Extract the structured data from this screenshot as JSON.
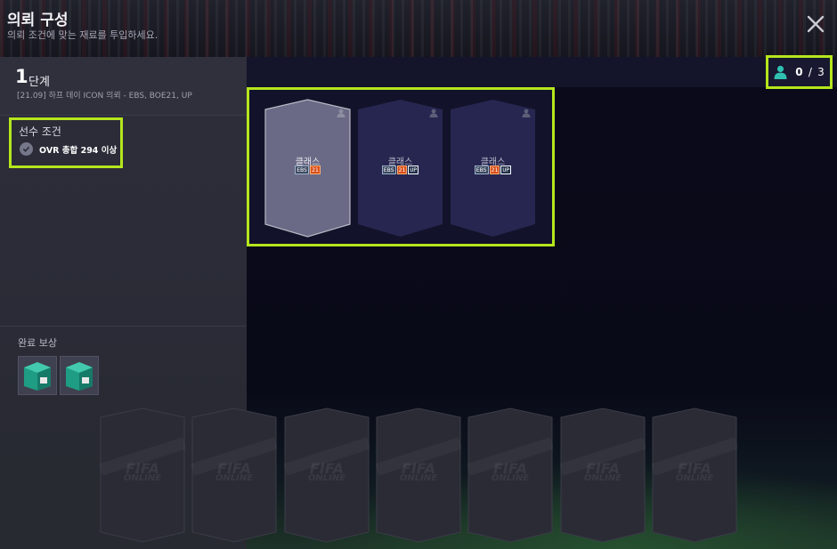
{
  "header": {
    "title": "의뢰 구성",
    "subtitle": "의뢰 조건에 맞는 재료를 투입하세요.",
    "close_icon": "close-icon"
  },
  "stage": {
    "number": "1",
    "word": "단계",
    "description": "[21.09] 하프 데이 ICON 의뢰 - EBS, BOE21, UP"
  },
  "conditions": {
    "title": "선수 조건",
    "items": [
      {
        "icon": "check-icon",
        "text": "OVR 총합 294 이상"
      }
    ]
  },
  "rewards": {
    "title": "완료 보상",
    "items": [
      {
        "icon": "player-pack-icon"
      },
      {
        "icon": "player-pack-icon"
      }
    ]
  },
  "counter": {
    "icon": "person-icon",
    "current": "0",
    "separator": "/",
    "total": "3",
    "accent": "#2fc0b0"
  },
  "slots": [
    {
      "label": "클래스",
      "tags": [
        "EBS",
        "21"
      ],
      "selected": true
    },
    {
      "label": "클래스",
      "tags": [
        "EBS",
        "21",
        "UP"
      ],
      "selected": false
    },
    {
      "label": "클래스",
      "tags": [
        "EBS",
        "21",
        "UP"
      ],
      "selected": false
    }
  ],
  "inventory": {
    "watermark_line1": "FIFA",
    "watermark_line2": "ONLINE",
    "card_count": 7
  },
  "colors": {
    "highlight": "#b5e61d",
    "tag_21": "#d8501c",
    "teal": "#2fc0b0"
  }
}
